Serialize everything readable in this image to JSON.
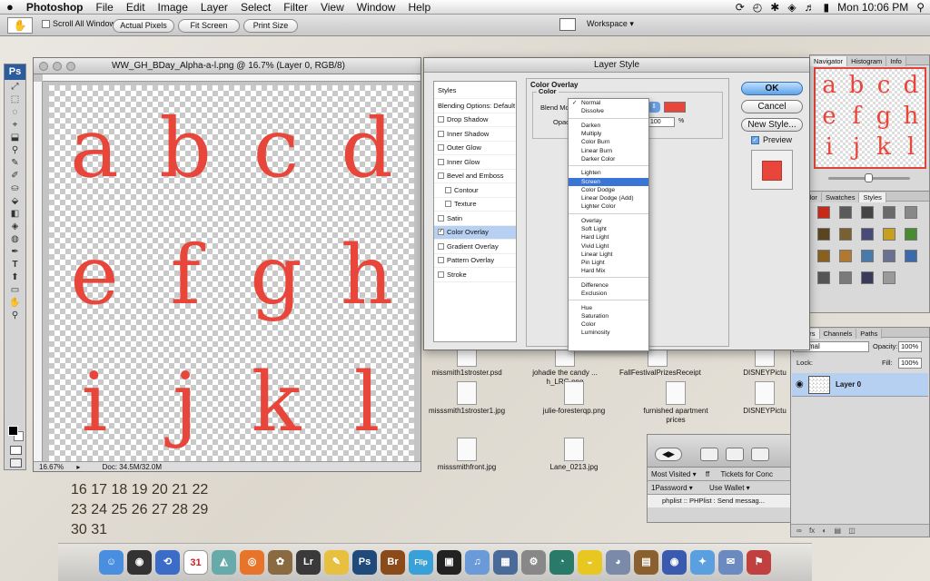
{
  "menubar": {
    "apple": "",
    "app": "Photoshop",
    "items": [
      "File",
      "Edit",
      "Image",
      "Layer",
      "Select",
      "Filter",
      "View",
      "Window",
      "Help"
    ],
    "clock": "Mon 10:06 PM"
  },
  "options_bar": {
    "scroll_all": "Scroll All Windows",
    "actual_pixels": "Actual Pixels",
    "fit_screen": "Fit Screen",
    "print_size": "Print Size",
    "workspace": "Workspace ▾"
  },
  "tools": {
    "logo": "Ps",
    "items": [
      "⤢",
      "⬚",
      "◌",
      "⌖",
      "⬓",
      "⚲",
      "✎",
      "✐",
      "⛀",
      "⬙",
      "◧",
      "◈",
      "◍",
      "✒",
      "T",
      "⬆",
      "▭",
      "✋",
      "⚲"
    ]
  },
  "document": {
    "title": "WW_GH_BDay_Alpha-a-l.png @ 16.7% (Layer 0, RGB/8)",
    "letters": [
      "a",
      "b",
      "c",
      "d",
      "e",
      "f",
      "g",
      "h",
      "i",
      "j",
      "k",
      "l"
    ],
    "zoom": "16.67%",
    "doc_size": "Doc: 34.5M/32.0M"
  },
  "layer_style": {
    "title": "Layer Style",
    "styles_header": "Styles",
    "blending_options": "Blending Options: Default",
    "effects": [
      {
        "label": "Drop Shadow",
        "checked": false,
        "indent": false
      },
      {
        "label": "Inner Shadow",
        "checked": false,
        "indent": false
      },
      {
        "label": "Outer Glow",
        "checked": false,
        "indent": false
      },
      {
        "label": "Inner Glow",
        "checked": false,
        "indent": false
      },
      {
        "label": "Bevel and Emboss",
        "checked": false,
        "indent": false
      },
      {
        "label": "Contour",
        "checked": false,
        "indent": true
      },
      {
        "label": "Texture",
        "checked": false,
        "indent": true
      },
      {
        "label": "Satin",
        "checked": false,
        "indent": false
      },
      {
        "label": "Color Overlay",
        "checked": true,
        "indent": false
      },
      {
        "label": "Gradient Overlay",
        "checked": false,
        "indent": false
      },
      {
        "label": "Pattern Overlay",
        "checked": false,
        "indent": false
      },
      {
        "label": "Stroke",
        "checked": false,
        "indent": false
      }
    ],
    "section_title": "Color Overlay",
    "group_title": "Color",
    "blend_mode_label": "Blend Mode:",
    "opacity_label": "Opacity:",
    "opacity_value": "100",
    "percent": "%",
    "ok": "OK",
    "cancel": "Cancel",
    "new_style": "New Style...",
    "preview": "Preview",
    "overlay_color": "#e8463a"
  },
  "blend_modes": {
    "groups": [
      [
        "Normal",
        "Dissolve"
      ],
      [
        "Darken",
        "Multiply",
        "Color Burn",
        "Linear Burn",
        "Darker Color"
      ],
      [
        "Lighten",
        "Screen",
        "Color Dodge",
        "Linear Dodge (Add)",
        "Lighter Color"
      ],
      [
        "Overlay",
        "Soft Light",
        "Hard Light",
        "Vivid Light",
        "Linear Light",
        "Pin Light",
        "Hard Mix"
      ],
      [
        "Difference",
        "Exclusion"
      ],
      [
        "Hue",
        "Saturation",
        "Color",
        "Luminosity"
      ]
    ],
    "checked": "Normal",
    "highlighted": "Screen"
  },
  "navigator": {
    "tabs": [
      "Navigator",
      "Histogram",
      "Info"
    ],
    "letters": [
      "a",
      "b",
      "c",
      "d",
      "e",
      "f",
      "g",
      "h",
      "i",
      "j",
      "k",
      "l"
    ]
  },
  "styles_panel": {
    "tabs": [
      "Color",
      "Swatches",
      "Styles"
    ]
  },
  "layers_panel": {
    "tabs": [
      "Layers",
      "Channels",
      "Paths"
    ],
    "blend": "Normal",
    "opacity_label": "Opacity:",
    "opacity": "100%",
    "lock_label": "Lock:",
    "fill_label": "Fill:",
    "fill": "100%",
    "layer_name": "Layer 0"
  },
  "safari": {
    "most_visited": "Most Visited ▾",
    "ff": "ff",
    "tickets": "Tickets for Conc",
    "onepassword": "1Password ▾",
    "wallet": "Use Wallet ▾",
    "tab": "phplist :: PHPlist : Send messag..."
  },
  "desktop_icons": [
    {
      "label": "missmith1stroster.psd"
    },
    {
      "label": "johadie the candy ... h_LRG.png"
    },
    {
      "label": "FallFestivalPrizesReceipt"
    },
    {
      "label": "DISNEYPictu"
    },
    {
      "label": "misssmith1stroster1.jpg"
    },
    {
      "label": "julie-foresterqp.png"
    },
    {
      "label": "furnished apartment prices"
    },
    {
      "label": "DISNEYPictu"
    },
    {
      "label": "misssmithfront.jpg"
    },
    {
      "label": "Lane_0213.jpg"
    }
  ],
  "calendar": {
    "rows": [
      "16 17 18 19 20 21 22",
      "23 24 25 26 27 28 29",
      "30 31"
    ]
  },
  "dock": {
    "items": [
      "☺",
      "◉",
      "⟲",
      "31",
      "◭",
      "◎",
      "✿",
      "Lr",
      "✎",
      "Ps",
      "Br",
      "Flip",
      "▣",
      "♫",
      "▦",
      "⚙",
      "◔",
      "◒",
      "◕",
      "▤",
      "◉",
      "✦",
      "✉",
      "⚑"
    ]
  }
}
